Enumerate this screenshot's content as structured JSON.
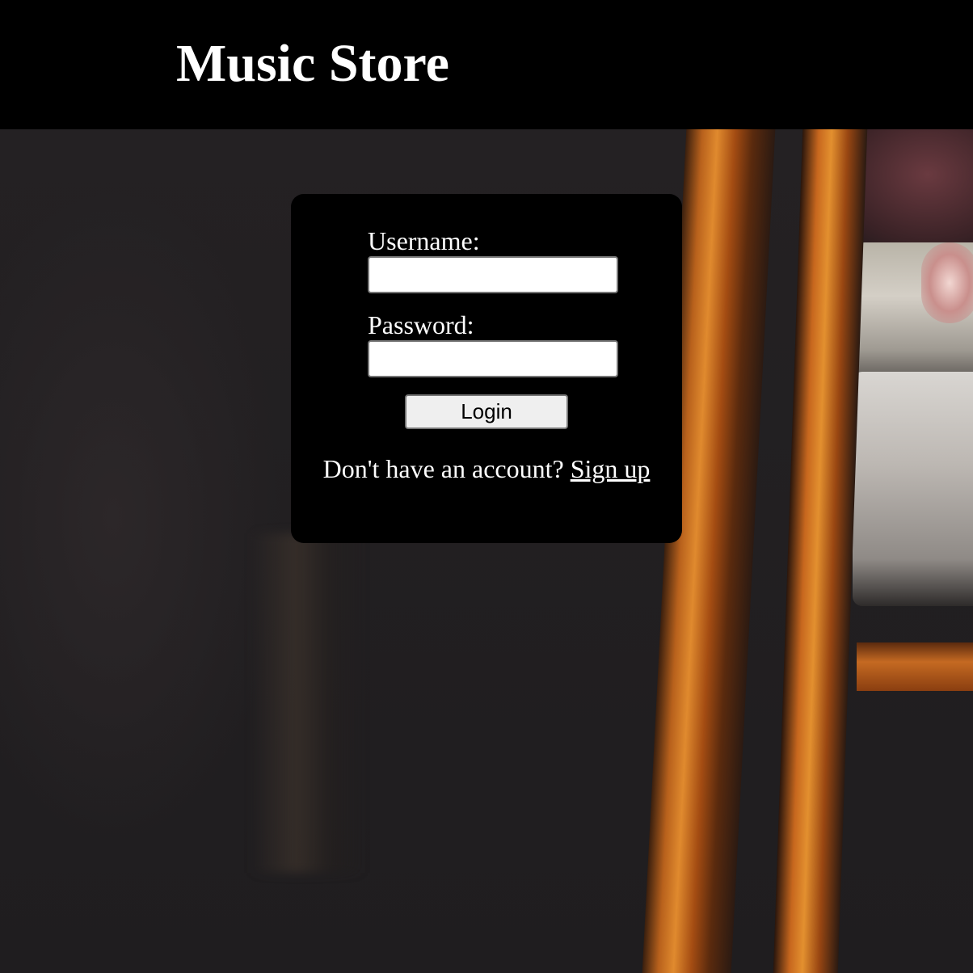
{
  "header": {
    "title": "Music Store"
  },
  "login": {
    "username_label": "Username:",
    "username_value": "",
    "password_label": "Password:",
    "password_value": "",
    "submit_label": "Login",
    "signup_prompt": "Don't have an account?",
    "signup_link": "Sign up"
  },
  "colors": {
    "header_bg": "#000000",
    "panel_bg": "#000000",
    "text": "#ffffff",
    "button_bg": "#efefef"
  }
}
